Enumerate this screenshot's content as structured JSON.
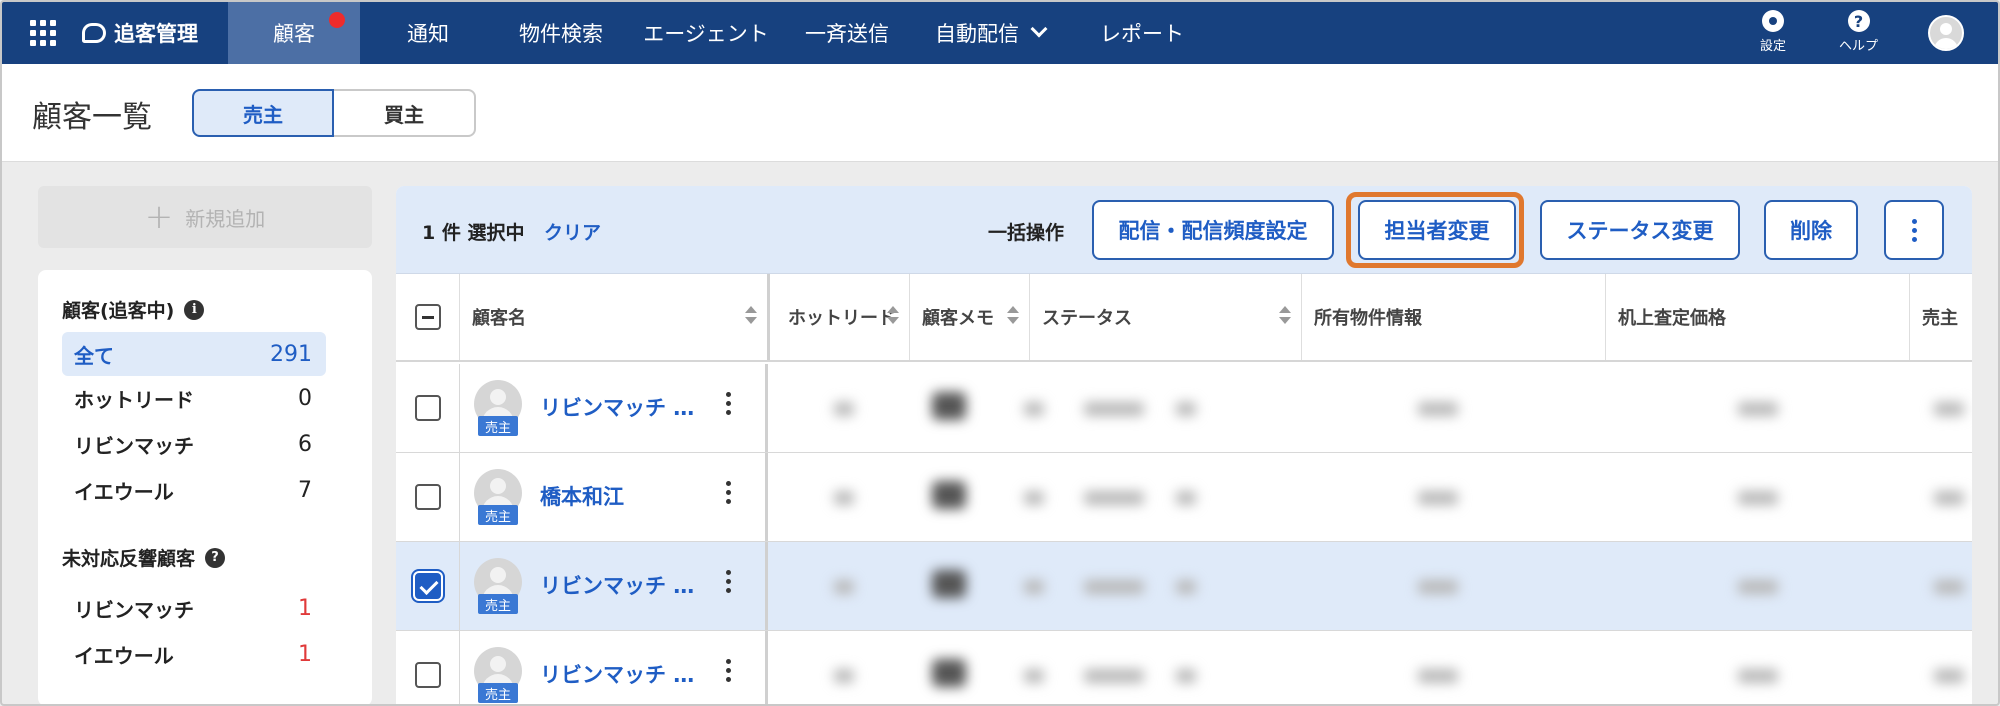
{
  "nav": {
    "brand": "追客管理",
    "items": [
      {
        "label": "顧客",
        "active": true
      },
      {
        "label": "通知"
      },
      {
        "label": "物件検索"
      },
      {
        "label": "エージェント"
      },
      {
        "label": "一斉送信"
      },
      {
        "label": "自動配信"
      },
      {
        "label": "レポート"
      }
    ],
    "settings_label": "設定",
    "help_label": "ヘルプ",
    "help_glyph": "?"
  },
  "page": {
    "title": "顧客一覧",
    "segments": [
      "売主",
      "買主"
    ],
    "selected_segment": "売主"
  },
  "sidebar": {
    "add_label": "新規追加",
    "add_glyph": "+",
    "info_glyph": "i",
    "section1": {
      "title": "顧客(追客中)",
      "rows": [
        {
          "label": "全て",
          "count": "291",
          "selected": true
        },
        {
          "label": "ホットリード",
          "count": "0"
        },
        {
          "label": "リビンマッチ",
          "count": "6"
        },
        {
          "label": "イエウール",
          "count": "7"
        }
      ]
    },
    "section2": {
      "title": "未対応反響顧客",
      "rows": [
        {
          "label": "リビンマッチ",
          "count": "1"
        },
        {
          "label": "イエウール",
          "count": "1"
        }
      ]
    }
  },
  "toolbar": {
    "selection_text": "1 件 選択中",
    "clear_label": "クリア",
    "bulk_label": "一括操作",
    "buttons": [
      "配信・配信頻度設定",
      "担当者変更",
      "ステータス変更",
      "削除"
    ],
    "highlighted_button": "担当者変更"
  },
  "table": {
    "columns": [
      "顧客名",
      "ホットリード",
      "顧客メモ",
      "ステータス",
      "所有物件情報",
      "机上査定価格",
      "売主"
    ],
    "rows": [
      {
        "name": "リビンマッチ …",
        "tag": "売主",
        "checked": false
      },
      {
        "name": "橋本和江",
        "tag": "売主",
        "checked": false
      },
      {
        "name": "リビンマッチ …",
        "tag": "売主",
        "checked": true
      },
      {
        "name": "リビンマッチ …",
        "tag": "売主",
        "checked": false
      }
    ]
  },
  "colors": {
    "nav_bg": "#17417f",
    "accent": "#1f5dc4",
    "highlight": "#e0782e",
    "alert": "#e03a3a"
  }
}
